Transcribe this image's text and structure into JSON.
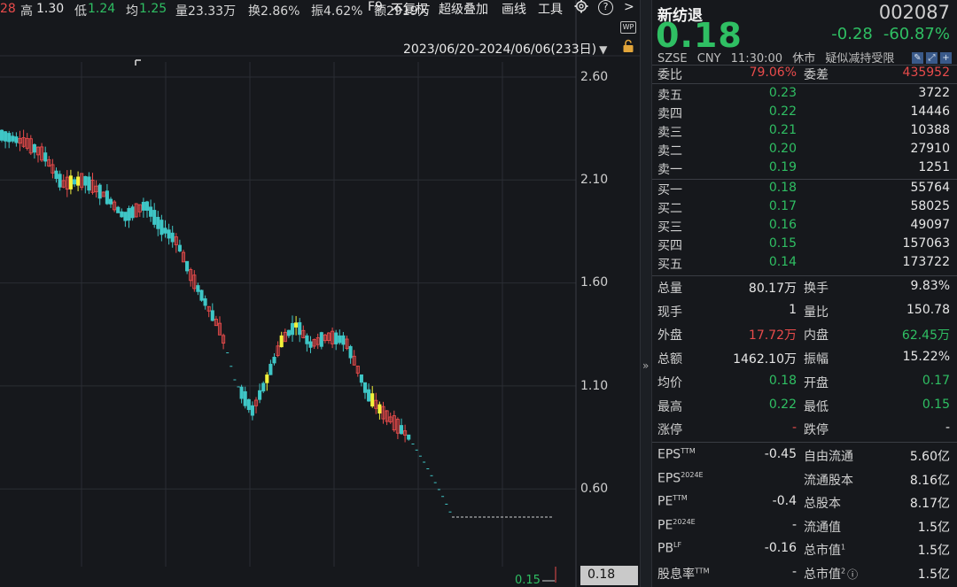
{
  "topbar": {
    "open_fragment": "28",
    "high_label": "高",
    "high_value": "1.30",
    "low_label": "低",
    "low_value": "1.24",
    "avg_label": "均",
    "avg_value": "1.25",
    "volume": "量23.33万",
    "turnover": "换2.86%",
    "amplitude": "振4.62%",
    "amount": "额2919万"
  },
  "menu": {
    "f9": "F9",
    "no_adjust": "不复权",
    "overlay": "超级叠加",
    "draw": "画线",
    "tools": "工具",
    "help": "?",
    "more": ">"
  },
  "range": {
    "text": "2023/06/20-2024/06/06(233日)",
    "icons": [
      "wp-icon",
      "lock-icon"
    ]
  },
  "chart_data": {
    "type": "candlestick",
    "yaxis_ticks": [
      "2.60",
      "2.10",
      "1.60",
      "1.10",
      "0.60"
    ],
    "last_price_label": "0.18",
    "low_label": "0.15",
    "colors": {
      "up": "#e84b4b",
      "down": "#3fc6c6",
      "limit_up": "#f2f23a",
      "grid": "#2a2d33"
    }
  },
  "stock": {
    "name": "新纺退",
    "code": "002087",
    "price": "0.18",
    "change": "-0.28",
    "change_pct": "-60.87%",
    "exchange": "SZSE",
    "currency": "CNY",
    "time": "11:30:00",
    "status": "休市",
    "note": "疑似减持受限"
  },
  "orderbook": {
    "ratio_label": "委比",
    "ratio_value": "79.06%",
    "diff_label": "委差",
    "diff_value": "435952",
    "asks": [
      {
        "label": "卖五",
        "price": "0.23",
        "vol": "3722"
      },
      {
        "label": "卖四",
        "price": "0.22",
        "vol": "14446"
      },
      {
        "label": "卖三",
        "price": "0.21",
        "vol": "10388"
      },
      {
        "label": "卖二",
        "price": "0.20",
        "vol": "27910"
      },
      {
        "label": "卖一",
        "price": "0.19",
        "vol": "1251"
      }
    ],
    "bids": [
      {
        "label": "买一",
        "price": "0.18",
        "vol": "55764"
      },
      {
        "label": "买二",
        "price": "0.17",
        "vol": "58025"
      },
      {
        "label": "买三",
        "price": "0.16",
        "vol": "49097"
      },
      {
        "label": "买四",
        "price": "0.15",
        "vol": "157063"
      },
      {
        "label": "买五",
        "price": "0.14",
        "vol": "173722"
      }
    ]
  },
  "stats": [
    {
      "l1": "总量",
      "v1": "80.17万",
      "l2": "换手",
      "v2": "9.83%"
    },
    {
      "l1": "现手",
      "v1": "1",
      "l2": "量比",
      "v2": "150.78"
    },
    {
      "l1": "外盘",
      "v1": "17.72万",
      "l2": "内盘",
      "v2": "62.45万"
    },
    {
      "l1": "总额",
      "v1": "1462.10万",
      "l2": "振幅",
      "v2": "15.22%"
    },
    {
      "l1": "均价",
      "v1": "0.18",
      "l2": "开盘",
      "v2": "0.17"
    },
    {
      "l1": "最高",
      "v1": "0.22",
      "l2": "最低",
      "v2": "0.15"
    },
    {
      "l1": "涨停",
      "v1": "-",
      "l2": "跌停",
      "v2": "-"
    }
  ],
  "fundamentals": [
    {
      "l1": "EPS",
      "s1": "TTM",
      "v1": "-0.45",
      "l2": "自由流通",
      "s2": "",
      "v2": "5.60亿"
    },
    {
      "l1": "EPS",
      "s1": "2024E",
      "v1": "",
      "l2": "流通股本",
      "s2": "",
      "v2": "8.16亿"
    },
    {
      "l1": "PE",
      "s1": "TTM",
      "v1": "-0.4",
      "l2": "总股本",
      "s2": "",
      "v2": "8.17亿"
    },
    {
      "l1": "PE",
      "s1": "2024E",
      "v1": "-",
      "l2": "流通值",
      "s2": "",
      "v2": "1.5亿"
    },
    {
      "l1": "PB",
      "s1": "LF",
      "v1": "-0.16",
      "l2": "总市值",
      "s2": "1",
      "v2": "1.5亿"
    },
    {
      "l1": "股息率",
      "s1": "TTM",
      "v1": "-",
      "l2": "总市值",
      "s2": "2",
      "v2": "1.5亿"
    }
  ]
}
